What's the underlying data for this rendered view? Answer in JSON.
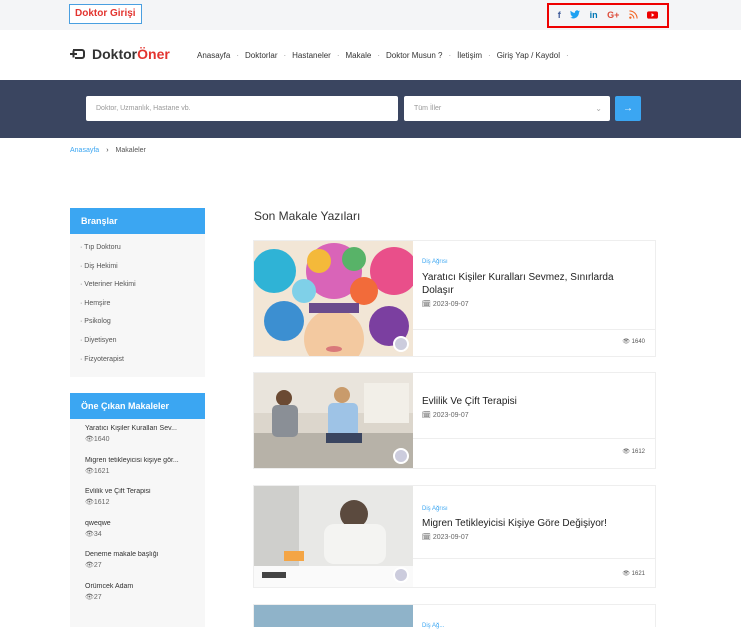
{
  "topbar": {
    "login_label": "Doktor Girişi",
    "social": [
      {
        "icon": "facebook-icon",
        "glyph": "f",
        "color": "#3b5998"
      },
      {
        "icon": "twitter-icon",
        "glyph": "🐦",
        "color": "#1da1f2"
      },
      {
        "icon": "linkedin-icon",
        "glyph": "in",
        "color": "#0077b5"
      },
      {
        "icon": "google-plus-icon",
        "glyph": "G+",
        "color": "#dd4b39"
      },
      {
        "icon": "rss-icon",
        "glyph": "◔",
        "color": "#f26522"
      },
      {
        "icon": "youtube-icon",
        "glyph": "▶",
        "color": "#e00000"
      }
    ]
  },
  "logo": {
    "part1": "Doktor",
    "part2": "Öner"
  },
  "nav": {
    "items": [
      "Anasayfa",
      "Doktorlar",
      "Hastaneler",
      "Makale",
      "Doktor Musun ?",
      "İletişim",
      "Giriş Yap / Kaydol"
    ]
  },
  "search": {
    "placeholder": "Doktor, Uzmanlık, Hastane vb.",
    "city_value": "Tüm İller",
    "button_glyph": "→"
  },
  "breadcrumb": {
    "home": "Anasayfa",
    "separator": "›",
    "current": "Makaleler"
  },
  "branches": {
    "title": "Branşlar",
    "items": [
      "Tıp Doktoru",
      "Diş Hekimi",
      "Veteriner Hekimi",
      "Hemşire",
      "Psikolog",
      "Diyetisyen",
      "Fizyoterapist"
    ]
  },
  "featured": {
    "title": "Öne Çıkan Makaleler",
    "items": [
      {
        "title": "Yaratıcı Kişiler Kuralları Sev...",
        "views": "1640"
      },
      {
        "title": "Migren tetikleyicisi kişiye gör...",
        "views": "1621"
      },
      {
        "title": "Evlilik ve Çift Terapisi",
        "views": "1612"
      },
      {
        "title": "qweqwe",
        "views": "34"
      },
      {
        "title": "Deneme makale başlığı",
        "views": "27"
      },
      {
        "title": "Örümcek Adam",
        "views": "27"
      }
    ]
  },
  "articles": {
    "section_title": "Son Makale Yazıları",
    "items": [
      {
        "category": "Diş Ağrısı",
        "title": "Yaratıcı Kişiler Kuralları Sevmez, Sınırlarda Dolaşır",
        "date": "2023-09-07",
        "views": "1640"
      },
      {
        "category": "",
        "title": "Evlilik Ve Çift Terapisi",
        "date": "2023-09-07",
        "views": "1612"
      },
      {
        "category": "Diş Ağrısı",
        "title": "Migren Tetikleyicisi Kişiye Göre Değişiyor!",
        "date": "2023-09-07",
        "views": "1621"
      },
      {
        "category": "Diş Ağ...",
        "title": "",
        "date": "",
        "views": ""
      }
    ]
  },
  "colors": {
    "accent": "#3ba6f2",
    "brand_red": "#e3342f",
    "search_band": "#3a4560"
  }
}
